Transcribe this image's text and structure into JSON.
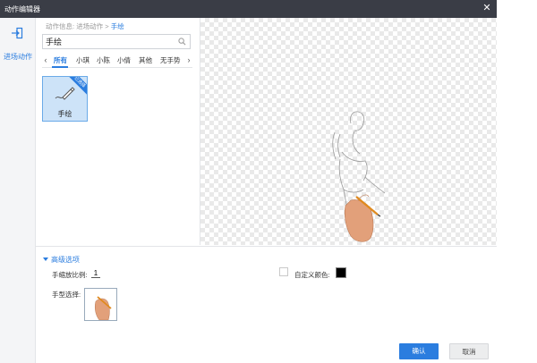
{
  "window": {
    "title": "动作编辑器",
    "close_icon": "close-icon"
  },
  "sidebar": {
    "items": [
      {
        "label": "进场动作",
        "icon": "enter-icon",
        "active": true
      }
    ]
  },
  "breadcrumb": {
    "root": "动作信息",
    "sep1": ":",
    "level1": "进场动作",
    "sep2": ">",
    "current": "手绘"
  },
  "search": {
    "value": "手绘",
    "placeholder": "",
    "icon": "search-icon"
  },
  "tabs": {
    "prev_icon": "chevron-left-icon",
    "next_icon": "chevron-right-icon",
    "items": [
      {
        "label": "所有",
        "active": true
      },
      {
        "label": "小琪"
      },
      {
        "label": "小陈"
      },
      {
        "label": "小倩"
      },
      {
        "label": "其他"
      },
      {
        "label": "无手势"
      }
    ]
  },
  "actions": [
    {
      "label": "手绘",
      "badge": "已选择",
      "icon": "hand-drawing-icon",
      "selected": true
    }
  ],
  "advanced": {
    "toggle_label": "高级选项",
    "scale_label": "手缩放比例:",
    "scale_value": "1",
    "custom_color_label": "自定义颜色:",
    "custom_color_checked": false,
    "custom_color": "#000000",
    "hand_type_label": "手型选择:"
  },
  "footer": {
    "confirm_label": "确认",
    "cancel_label": "取消"
  },
  "colors": {
    "accent": "#2b7ddf",
    "titlebar": "#3a3d46"
  }
}
